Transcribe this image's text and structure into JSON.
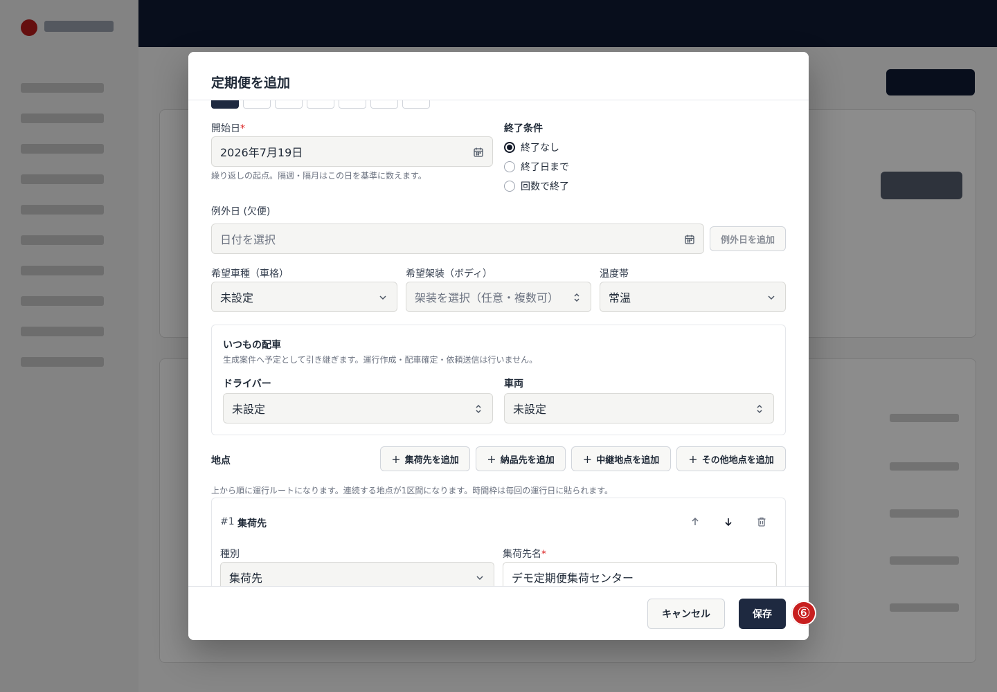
{
  "modal": {
    "title": "定期便を追加",
    "start_date": {
      "label": "開始日",
      "required_mark": "*",
      "value": "2026年7月19日",
      "hint": "繰り返しの起点。隔週・隔月はこの日を基準に数えます。"
    },
    "end_condition": {
      "label": "終了条件",
      "options": [
        "終了なし",
        "終了日まで",
        "回数で終了"
      ],
      "selected": "終了なし"
    },
    "exception": {
      "label": "例外日 (欠便)",
      "placeholder": "日付を選択",
      "add_button": "例外日を追加"
    },
    "vehicle_class": {
      "label": "希望車種（車格）",
      "value": "未設定"
    },
    "body_type": {
      "label": "希望架装（ボディ）",
      "placeholder": "架装を選択（任意・複数可）"
    },
    "temperature": {
      "label": "温度帯",
      "value": "常温"
    },
    "usual_dispatch": {
      "title": "いつもの配車",
      "hint": "生成案件へ予定として引き継ぎます。運行作成・配車確定・依頼送信は行いません。",
      "driver": {
        "label": "ドライバー",
        "value": "未設定"
      },
      "vehicle": {
        "label": "車両",
        "value": "未設定"
      }
    },
    "locations": {
      "label": "地点",
      "buttons": {
        "pickup": "集荷先を追加",
        "delivery": "納品先を追加",
        "relay": "中継地点を追加",
        "other": "その他地点を追加"
      },
      "hint": "上から順に運行ルートになります。連続する地点が1区間になります。時間枠は毎回の運行日に貼られます。",
      "items": [
        {
          "index": "#1",
          "title": "集荷先",
          "kind_label": "種別",
          "kind_value": "集荷先",
          "name_label": "集荷先名",
          "required_mark": "*",
          "name_value": "デモ定期便集荷センター"
        }
      ]
    },
    "footer": {
      "cancel": "キャンセル",
      "save": "保存"
    }
  },
  "step_badge": "⑥",
  "colors": {
    "primary": "#1e2940",
    "required": "#dc2626",
    "badge": "#c81e1e"
  }
}
